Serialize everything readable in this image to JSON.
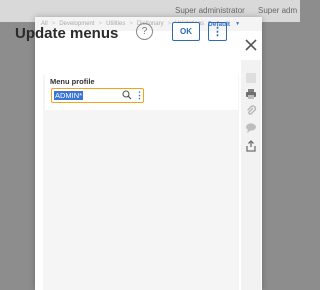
{
  "background": {
    "users": [
      "Super administrator",
      "Super adm"
    ]
  },
  "modal": {
    "breadcrumb": [
      "All",
      "Development",
      "Utilities",
      "Dictionary",
      "Validations"
    ],
    "breadcrumb_active": "Default",
    "title": "Update menus",
    "help_label": "?",
    "ok_label": "OK",
    "more_label": "⋮"
  },
  "form": {
    "field_label": "Menu profile",
    "field_value": "ADMIN*"
  },
  "side_rail": {
    "icons": [
      "add-icon",
      "print-icon",
      "attachment-icon",
      "comment-icon",
      "share-icon"
    ]
  },
  "colors": {
    "accent": "#2d6bb7",
    "focus_border": "#f1a51a",
    "selection": "#3875d7",
    "overlay": "#8d8d8d"
  }
}
